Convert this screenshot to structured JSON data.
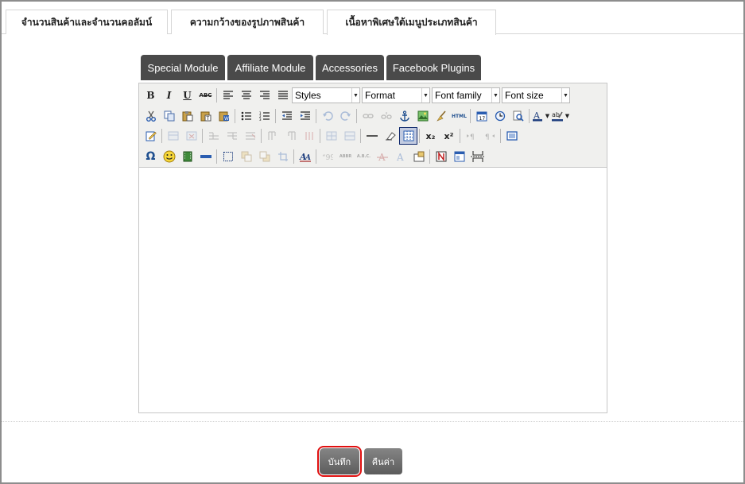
{
  "tabs": [
    {
      "label": "จำนวนสินค้าและจำนวนคอลัมน์"
    },
    {
      "label": "ความกว้างของรูปภาพสินค้า"
    },
    {
      "label": "เนื้อหาพิเศษใต้เมนูประเภทสินค้า",
      "active": true
    }
  ],
  "subtabs": [
    {
      "label": "Special Module"
    },
    {
      "label": "Affiliate Module"
    },
    {
      "label": "Accessories"
    },
    {
      "label": "Facebook Plugins"
    }
  ],
  "editor": {
    "dropdowns": {
      "styles": "Styles",
      "format": "Format",
      "font_family": "Font family",
      "font_size": "Font size"
    },
    "toolbar_glyphs": {
      "bold": "B",
      "italic": "I",
      "underline": "U",
      "strike": "ABC",
      "html": "HTML",
      "subscript": "x₂",
      "superscript": "x²",
      "omega": "Ω",
      "abbr": "ABBR",
      "acronym": "A.B.C."
    },
    "content": ""
  },
  "buttons": {
    "save": "บันทึก",
    "reset": "คืนค่า"
  },
  "colors": {
    "subtab_bg": "#4a4a4a",
    "button_bg": "#6e6e6e",
    "highlight": "#e01010",
    "toolbar_bg": "#f0f0ee"
  }
}
